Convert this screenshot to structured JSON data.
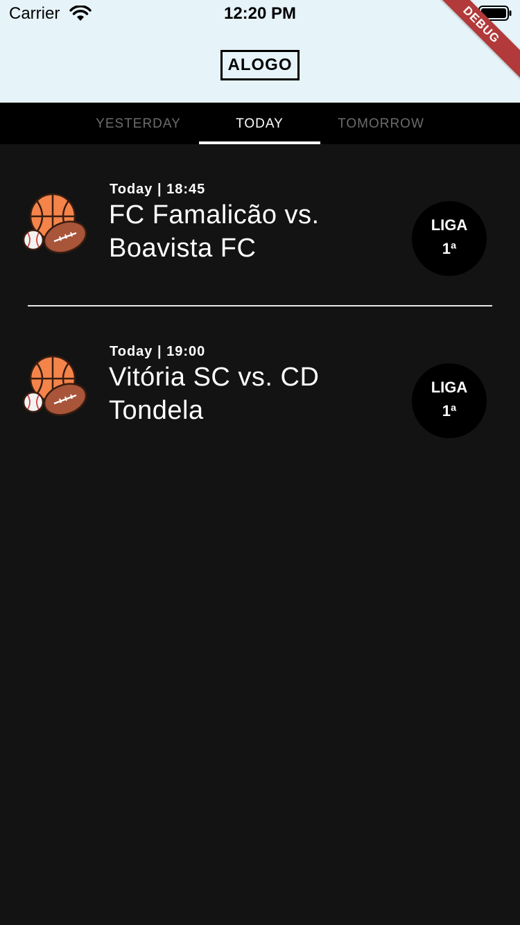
{
  "status_bar": {
    "carrier": "Carrier",
    "time": "12:20 PM"
  },
  "debug_banner": "DEBUG",
  "header": {
    "logo": "ALOGO"
  },
  "tabs": [
    {
      "label": "YESTERDAY",
      "active": false
    },
    {
      "label": "TODAY",
      "active": true
    },
    {
      "label": "TOMORROW",
      "active": false
    }
  ],
  "matches": [
    {
      "time": "Today | 18:45",
      "title": "FC Famalicão vs. Boavista FC",
      "league": {
        "name": "LIGA",
        "tier": "1ª"
      },
      "icon": "sports-balls-icon"
    },
    {
      "time": "Today | 19:00",
      "title": "Vitória SC vs. CD Tondela",
      "league": {
        "name": "LIGA",
        "tier": "1ª"
      },
      "icon": "sports-balls-icon"
    }
  ],
  "colors": {
    "header_bg": "#e6f3f9",
    "tab_bar_bg": "#000000",
    "content_bg": "#131313",
    "debug_banner": "#b23a3a",
    "basketball": "#f4844a",
    "football": "#a8553a"
  }
}
